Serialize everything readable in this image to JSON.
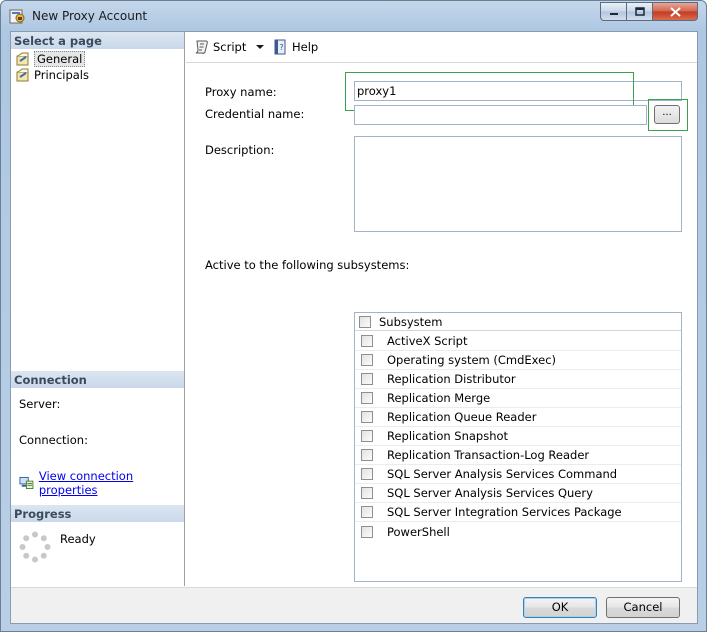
{
  "window": {
    "title": "New Proxy Account"
  },
  "left": {
    "select_page_header": "Select a page",
    "pages": [
      {
        "label": "General",
        "icon": "page-icon",
        "selected": true
      },
      {
        "label": "Principals",
        "icon": "page-icon",
        "selected": false
      }
    ],
    "connection_header": "Connection",
    "server_label": "Server:",
    "connection_label": "Connection:",
    "view_connection_link": "View connection properties",
    "progress_header": "Progress",
    "progress_status": "Ready"
  },
  "toolbar": {
    "script_label": "Script",
    "help_label": "Help"
  },
  "form": {
    "proxy_name_label": "Proxy name:",
    "proxy_name_value": "proxy1",
    "credential_name_label": "Credential name:",
    "credential_name_value": "",
    "browse_label": "...",
    "description_label": "Description:",
    "description_value": "",
    "subsystems_label": "Active to the following subsystems:",
    "subsystem_header": "Subsystem",
    "subsystems": [
      "ActiveX Script",
      "Operating system (CmdExec)",
      "Replication Distributor",
      "Replication Merge",
      "Replication Queue Reader",
      "Replication Snapshot",
      "Replication Transaction-Log Reader",
      "SQL Server Analysis Services Command",
      "SQL Server Analysis Services Query",
      "SQL Server Integration Services Package",
      "PowerShell"
    ]
  },
  "footer": {
    "ok_label": "OK",
    "cancel_label": "Cancel"
  },
  "colors": {
    "highlight": "#3aa24a",
    "link": "#0000ee",
    "section_header": "#c9d8ea"
  }
}
